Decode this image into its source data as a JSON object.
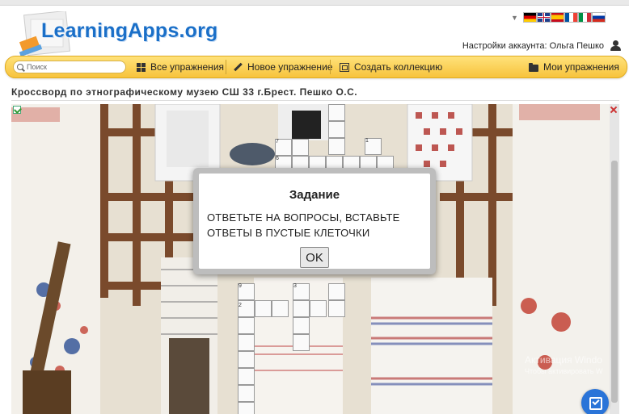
{
  "site": {
    "logo_text": "LearningApps.org"
  },
  "header": {
    "account_label": "Настройки аккаунта:",
    "account_name": "Ольга Пешко",
    "languages": [
      "de",
      "gb",
      "es",
      "fr",
      "it",
      "ru"
    ]
  },
  "nav": {
    "search_placeholder": "Поиск",
    "all_exercises": "Все упражнения",
    "new_exercise": "Новое упражнение",
    "create_collection": "Создать коллекцию",
    "my_exercises": "Мои упражнения"
  },
  "app": {
    "title": "Кроссворд по этнографическому музею СШ 33 г.Брест. Пешко О.С.",
    "cell_numbers": [
      "7",
      "6",
      "1",
      "9",
      "3",
      "2"
    ],
    "dialog": {
      "title": "Задание",
      "text": "ОТВЕТЬТЕ НА ВОПРОСЫ, ВСТАВЬТЕ ОТВЕТЫ В ПУСТЫЕ КЛЕТОЧКИ",
      "ok_label": "OK"
    },
    "watermark_line1": "Активация Windo",
    "watermark_line2": "Чтобы активировать W"
  },
  "colors": {
    "nav_yellow": "#f7c33c",
    "logo_blue": "#1a6fc8",
    "check_blue": "#2a74d8"
  }
}
